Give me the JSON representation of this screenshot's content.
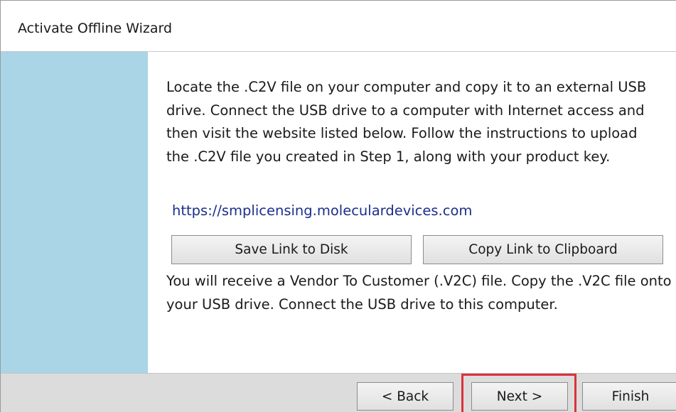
{
  "window": {
    "title": "Activate Offline Wizard"
  },
  "content": {
    "instructions": "Locate the .C2V file on your computer and copy it to an external USB drive. Connect the USB drive to a computer with Internet access and then visit the website listed below. Follow the instructions to upload the .C2V file you created in Step 1, along with your product key.",
    "link": "https://smplicensing.moleculardevices.com",
    "save_link_label": "Save Link to Disk",
    "copy_link_label": "Copy Link to Clipboard",
    "followup": "You will receive a Vendor To Customer (.V2C) file. Copy the .V2C file onto your USB drive. Connect the USB drive to this computer."
  },
  "footer": {
    "back_label": "< Back",
    "next_label": "Next >",
    "finish_label": "Finish"
  },
  "colors": {
    "side_panel": "#a9d5e6",
    "link": "#1b2f8a",
    "highlight": "#d9333b",
    "footer": "#dcdcdc"
  }
}
